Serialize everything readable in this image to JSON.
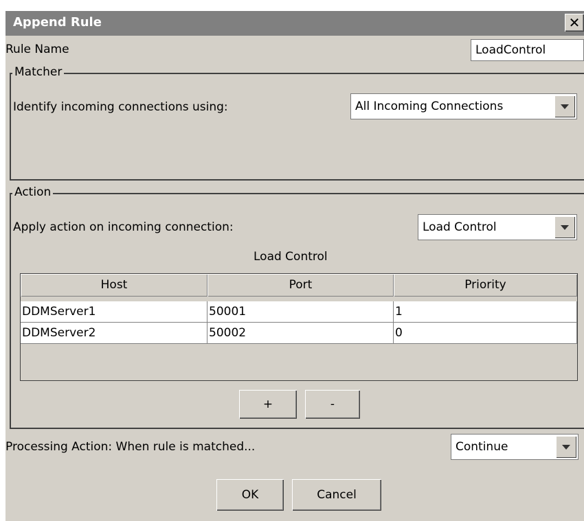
{
  "dialog": {
    "title": "Append Rule",
    "close_label": "✕"
  },
  "rule_name": {
    "label": "Rule Name",
    "value": "LoadControl"
  },
  "matcher": {
    "legend": "Matcher",
    "identify_label": "Identify incoming connections using:",
    "identify_value": "All Incoming Connections"
  },
  "action": {
    "legend": "Action",
    "apply_label": "Apply action on incoming connection:",
    "apply_value": "Load Control",
    "table_title": "Load Control",
    "columns": [
      "Host",
      "Port",
      "Priority"
    ],
    "rows": [
      {
        "host": "DDMServer1",
        "port": "50001",
        "priority": "1"
      },
      {
        "host": "DDMServer2",
        "port": "50002",
        "priority": "0"
      }
    ],
    "add_label": "+",
    "remove_label": "-"
  },
  "processing": {
    "label": "Processing Action: When rule is matched...",
    "value": "Continue"
  },
  "buttons": {
    "ok": "OK",
    "cancel": "Cancel"
  },
  "icons": {
    "close": "close-icon",
    "dropdown": "chevron-down-icon"
  }
}
